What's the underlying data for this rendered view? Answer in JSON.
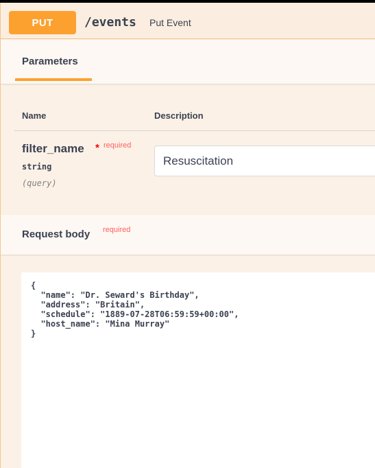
{
  "operation": {
    "method": "PUT",
    "path": "/events",
    "summary": "Put Event",
    "accent_color": "#fca130"
  },
  "tabs": {
    "parameters_label": "Parameters"
  },
  "parameters_table": {
    "name_header": "Name",
    "description_header": "Description",
    "params": [
      {
        "name": "filter_name",
        "required_marker": "*",
        "required_label": "required",
        "type": "string",
        "in": "(query)",
        "value": "Resuscitation"
      }
    ]
  },
  "request_body": {
    "title": "Request body",
    "required_label": "required",
    "value": "{\n  \"name\": \"Dr. Seward's Birthday\",\n  \"address\": \"Britain\",\n  \"schedule\": \"1889-07-28T06:59:59+00:00\",\n  \"host_name\": \"Mina Murray\"\n}"
  }
}
